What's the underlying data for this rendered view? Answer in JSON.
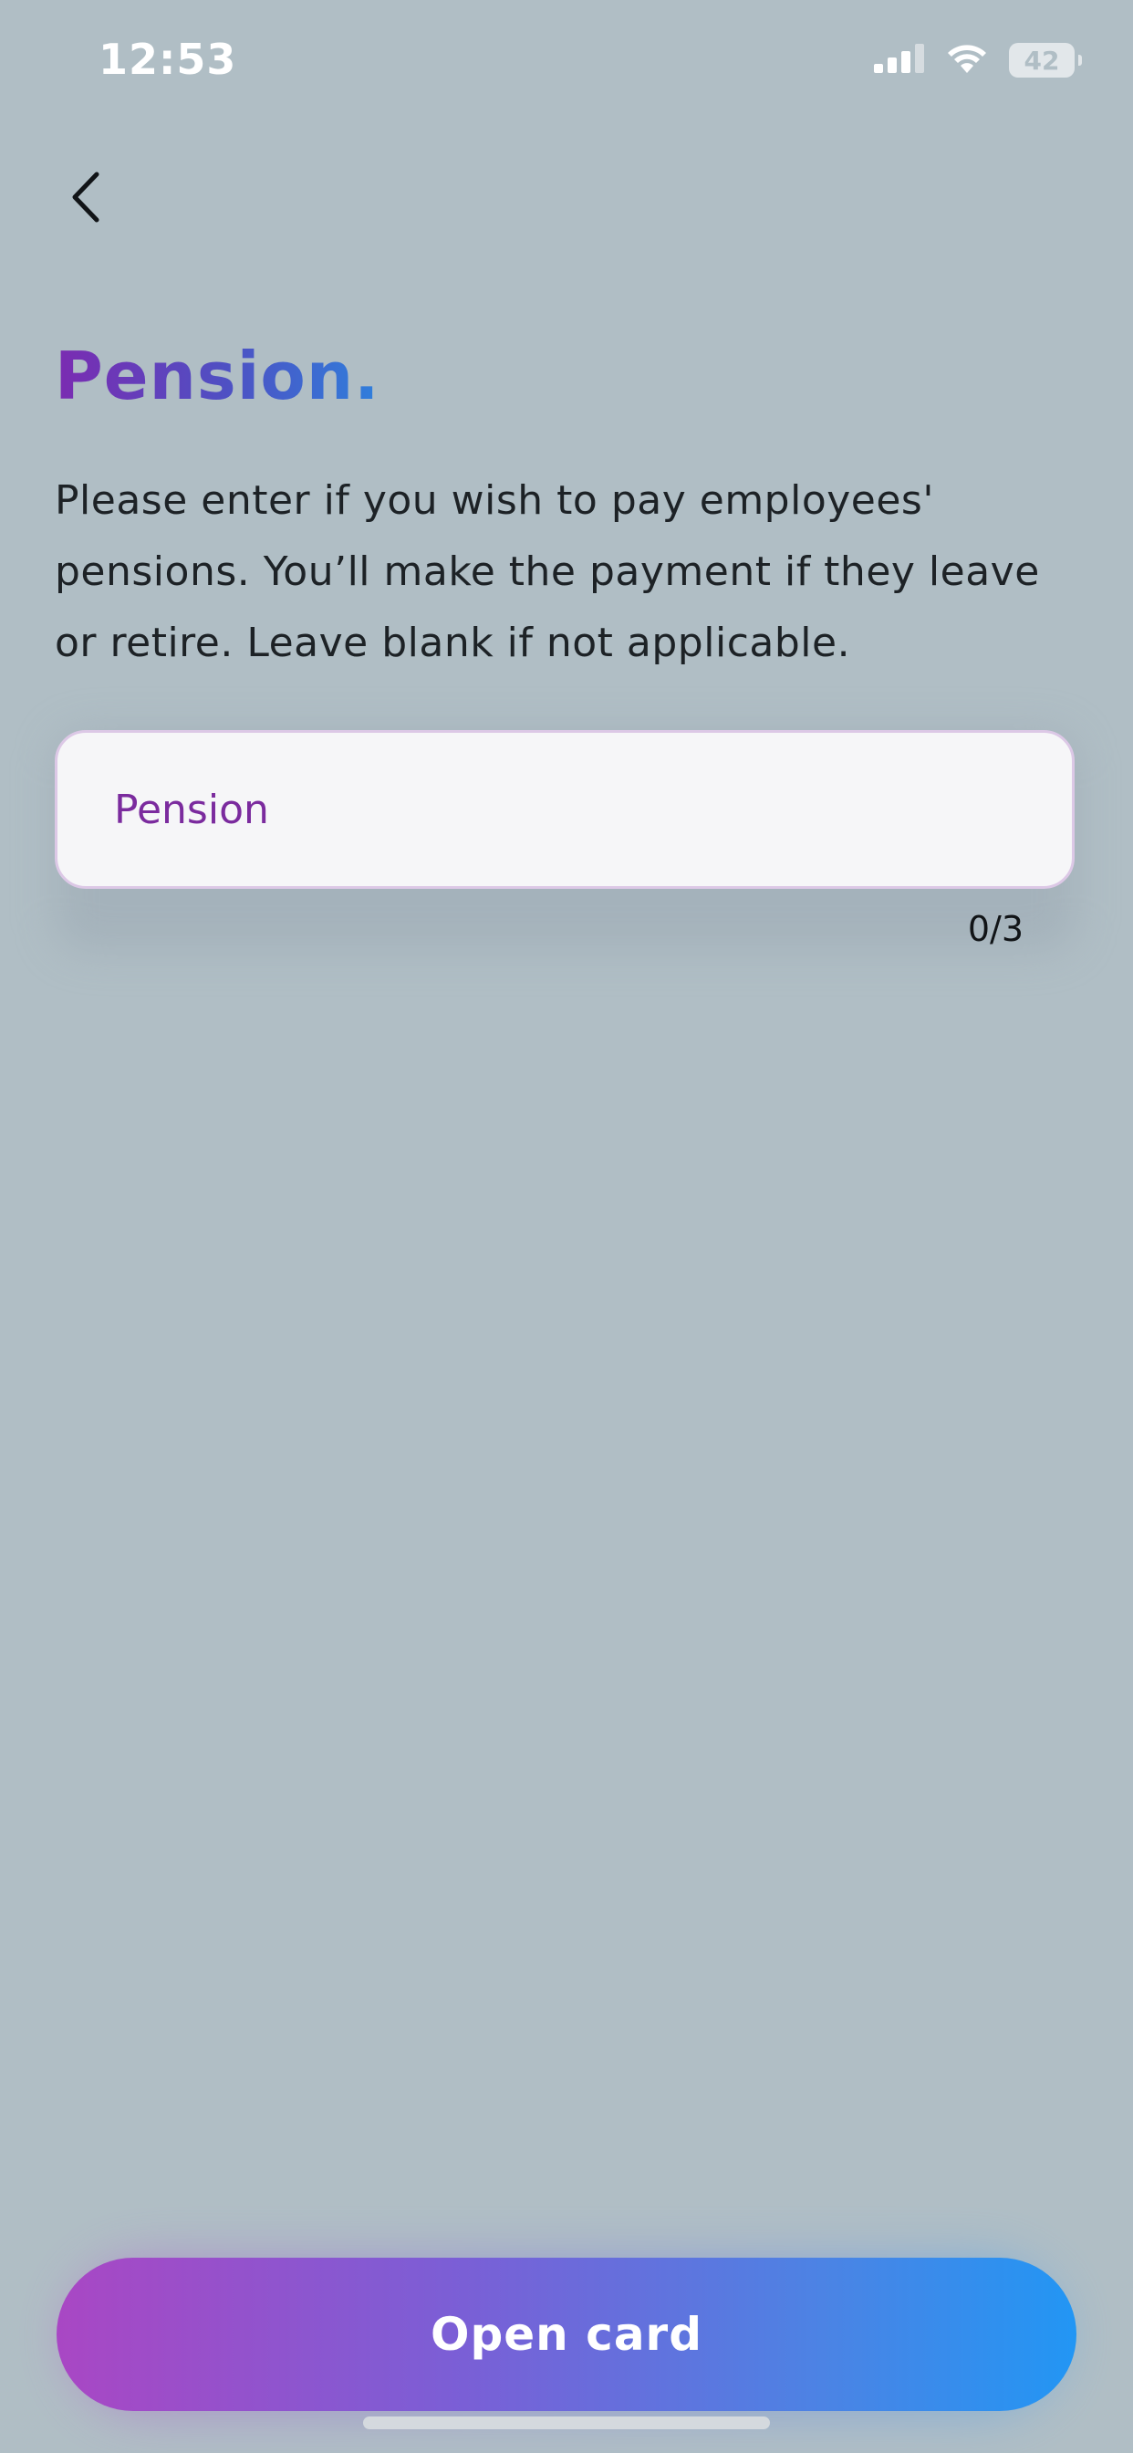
{
  "status_bar": {
    "time": "12:53",
    "battery": "42"
  },
  "icons": {
    "back": "chevron-left-icon",
    "signal": "cellular-signal-icon",
    "wifi": "wifi-icon",
    "battery": "battery-icon"
  },
  "header": {
    "title": "Pension."
  },
  "body": {
    "description": "Please enter if you wish to pay employees' pensions. You’ll make the payment if they leave or retire. Leave blank if not applicable."
  },
  "pension_input": {
    "value": "",
    "placeholder": "Pension",
    "counter": "0/3"
  },
  "footer": {
    "cta_label": "Open card"
  },
  "colors": {
    "background": "#b0bec5",
    "title_gradient_start": "#7b2bb1",
    "title_gradient_end": "#2f7fdc",
    "button_gradient_start": "#a947c4",
    "button_gradient_end": "#2296f4",
    "input_text": "#7b2b9e"
  }
}
